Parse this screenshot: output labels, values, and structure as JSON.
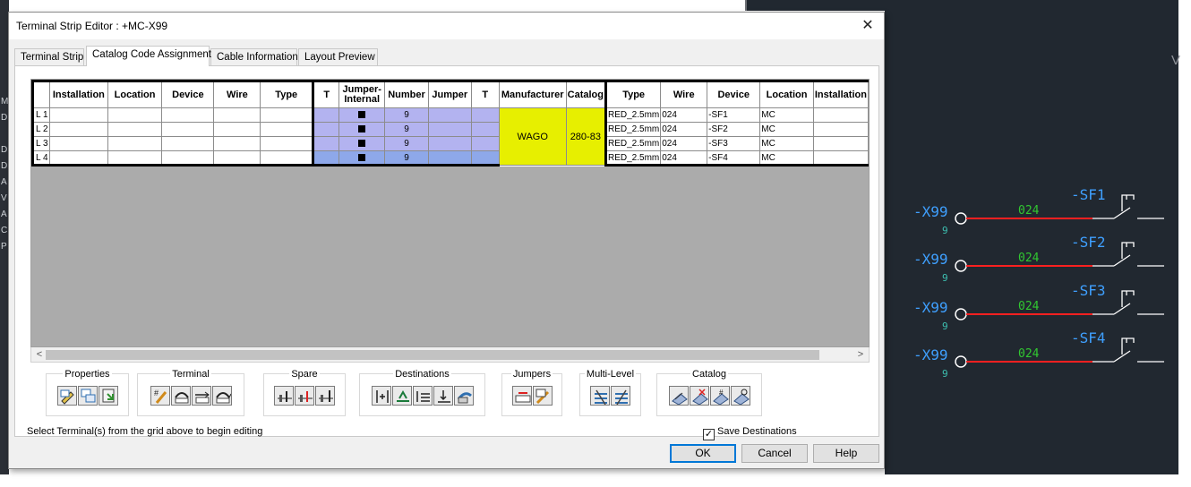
{
  "dialog": {
    "title": "Terminal Strip Editor : +MC-X99",
    "close_glyph": "✕"
  },
  "tabs": [
    {
      "label": "Terminal Strip"
    },
    {
      "label": "Catalog Code Assignment"
    },
    {
      "label": "Cable Information"
    },
    {
      "label": "Layout Preview"
    }
  ],
  "grid": {
    "headers": [
      "",
      "Installation",
      "Location",
      "Device",
      "Wire",
      "Type",
      "T",
      "Jumper-Internal",
      "Number",
      "Jumper",
      "T",
      "Manufacturer",
      "Catalog",
      "Type",
      "Wire",
      "Device",
      "Location",
      "Installation"
    ],
    "rows": [
      {
        "label": "L 1",
        "number": "9",
        "type": "RED_2.5mm",
        "wire": "024",
        "device": "-SF1",
        "location": "MC"
      },
      {
        "label": "L 2",
        "number": "9",
        "type": "RED_2.5mm",
        "wire": "024",
        "device": "-SF2",
        "location": "MC"
      },
      {
        "label": "L 3",
        "number": "9",
        "type": "RED_2.5mm",
        "wire": "024",
        "device": "-SF3",
        "location": "MC"
      },
      {
        "label": "L 4",
        "number": "9",
        "type": "RED_2.5mm",
        "wire": "024",
        "device": "-SF4",
        "location": "MC"
      }
    ],
    "manufacturer": "WAGO",
    "catalog": "280-83"
  },
  "scrollbar": {
    "left": "<",
    "right": ">"
  },
  "groups": [
    {
      "label": "Properties",
      "icons": [
        "edit-properties-icon",
        "copy-properties-icon",
        "paste-properties-icon"
      ]
    },
    {
      "label": "Terminal",
      "icons": [
        "edit-terminal-icon",
        "reverse-terminal-icon",
        "move-terminal-icon",
        "rotate-terminal-icon"
      ]
    },
    {
      "label": "Spare",
      "icons": [
        "add-spare-icon",
        "delete-spare-icon",
        "spare-after-icon"
      ]
    },
    {
      "label": "Destinations",
      "icons": [
        "move-destination-icon",
        "swap-destination-icon",
        "destination-up-icon",
        "destination-down-icon",
        "destination-reverse-icon"
      ]
    },
    {
      "label": "Jumpers",
      "icons": [
        "add-jumper-icon",
        "edit-jumper-icon"
      ]
    },
    {
      "label": "Multi-Level",
      "icons": [
        "split-level-icon",
        "merge-level-icon"
      ]
    },
    {
      "label": "Catalog",
      "icons": [
        "assign-catalog-icon",
        "delete-catalog-icon",
        "copy-catalog-icon",
        "lookup-catalog-icon"
      ]
    }
  ],
  "status": {
    "hint": "Select Terminal(s) from the grid above to begin editing"
  },
  "save_destinations": {
    "label": "Save Destinations",
    "checked": true,
    "mark": "✓"
  },
  "buttons": {
    "ok": "OK",
    "cancel": "Cancel",
    "help": "Help"
  },
  "cad": {
    "left_marks": [
      "D",
      "D",
      "A",
      "V",
      "A",
      "C",
      "P",
      "M",
      "D"
    ],
    "partial_letter": "V",
    "rungs": [
      {
        "terminal": "-X99",
        "pin": "9",
        "wire": "024",
        "device": "-SF1"
      },
      {
        "terminal": "-X99",
        "pin": "9",
        "wire": "024",
        "device": "-SF2"
      },
      {
        "terminal": "-X99",
        "pin": "9",
        "wire": "024",
        "device": "-SF3"
      },
      {
        "terminal": "-X99",
        "pin": "9",
        "wire": "024",
        "device": "-SF4"
      }
    ],
    "colors": {
      "terminal": "#3fa0ff",
      "pin": "#3dbfb0",
      "wire_label": "#31c731",
      "wire": "#ff2020",
      "device": "#3fa0ff",
      "symbol": "#ffffff"
    }
  }
}
